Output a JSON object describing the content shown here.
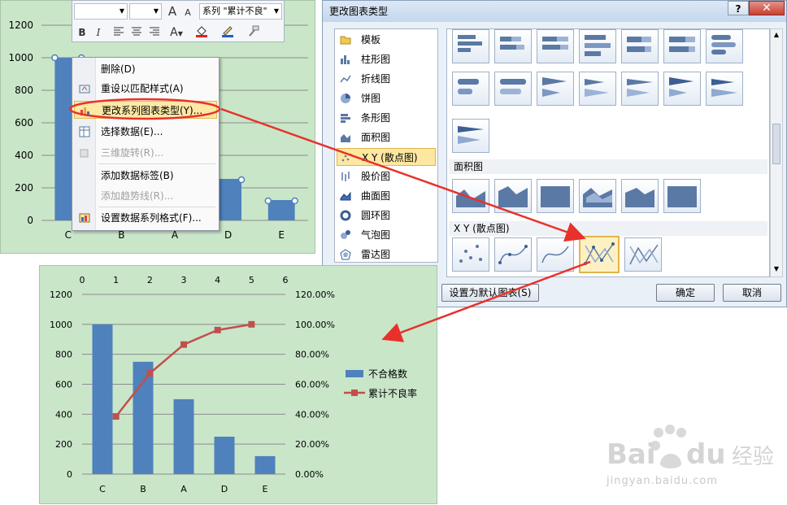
{
  "mini_toolbar": {
    "bold_label": "B",
    "italic_label": "I",
    "series_combo": "系列 \"累计不良\"",
    "font_grow": "A",
    "font_shrink": "A"
  },
  "context_menu": {
    "items": [
      {
        "label": "删除(D)",
        "disabled": false
      },
      {
        "label": "重设以匹配样式(A)",
        "disabled": false
      },
      {
        "label": "更改系列图表类型(Y)...",
        "disabled": false,
        "highlight": true
      },
      {
        "label": "选择数据(E)...",
        "disabled": false
      },
      {
        "label": "三维旋转(R)...",
        "disabled": true
      },
      {
        "label": "添加数据标签(B)",
        "disabled": false
      },
      {
        "label": "添加趋势线(R)...",
        "disabled": true
      },
      {
        "label": "设置数据系列格式(F)...",
        "disabled": false
      }
    ]
  },
  "dialog": {
    "title": "更改图表类型",
    "help": "?",
    "close": "✕",
    "types": [
      "模板",
      "柱形图",
      "折线图",
      "饼图",
      "条形图",
      "面积图",
      "X Y (散点图)",
      "股价图",
      "曲面图",
      "圆环图",
      "气泡图",
      "雷达图"
    ],
    "selected_type": "X Y (散点图)",
    "sections": [
      "面积图",
      "X Y (散点图)"
    ],
    "set_default": "设置为默认图表(S)",
    "ok": "确定",
    "cancel": "取消"
  },
  "chart_data": [
    {
      "type": "bar",
      "categories": [
        "C",
        "B",
        "A",
        "D",
        "E"
      ],
      "y_ticks": [
        "0",
        "200",
        "400",
        "600",
        "800",
        "1000",
        "1200"
      ],
      "ylim": [
        0,
        1200
      ],
      "series": [
        {
          "values": [
            1000,
            750,
            500,
            250,
            120
          ],
          "color": "#4f81bd"
        }
      ],
      "markers": [
        {
          "category": "D",
          "value": 250
        },
        {
          "category": "E",
          "value": 120
        }
      ],
      "grid": true
    },
    {
      "type": "bar",
      "categories": [
        "C",
        "B",
        "A",
        "D",
        "E"
      ],
      "y_ticks": [
        "0",
        "200",
        "400",
        "600",
        "800",
        "1000",
        "1200"
      ],
      "y2_ticks": [
        "0.00%",
        "20.00%",
        "40.00%",
        "60.00%",
        "80.00%",
        "100.00%",
        "120.00%"
      ],
      "x2_ticks": [
        "0",
        "1",
        "2",
        "3",
        "4",
        "5",
        "6"
      ],
      "ylim": [
        0,
        1200
      ],
      "y2lim": [
        0,
        1.2
      ],
      "x2lim": [
        0,
        6
      ],
      "series": [
        {
          "name": "不合格数",
          "type": "bar",
          "color": "#4f81bd",
          "values": [
            1000,
            750,
            500,
            250,
            120
          ]
        },
        {
          "name": "累计不良率",
          "type": "scatter-line",
          "color": "#c0504d",
          "x": [
            1,
            2,
            3,
            4,
            5
          ],
          "values": [
            0.385,
            0.673,
            0.865,
            0.962,
            1.0
          ]
        }
      ],
      "legend": "right",
      "grid": true
    }
  ],
  "watermark": {
    "url": "jingyan.baidu.com"
  },
  "colors": {
    "chart_bg": "#c9e6c9",
    "bar": "#4f81bd",
    "line": "#c0504d",
    "arrow": "#e8312a",
    "menu_highlight": "#fde8a6"
  }
}
